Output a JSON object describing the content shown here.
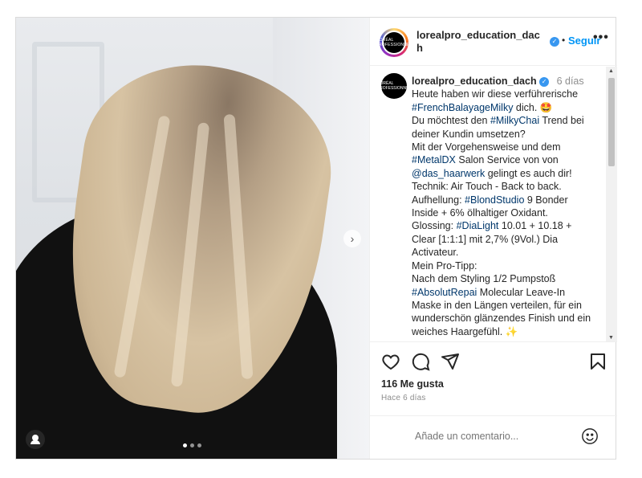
{
  "post": {
    "username": "lorealpro_education_dach",
    "username_wrapped": "lorealpro_education_dac h",
    "logo_text": "L'ORÉAL PROFESSIONNEL",
    "dot_separator": "•",
    "follow_label": "Seguir",
    "more_label": "•••",
    "next_arrow": "›"
  },
  "caption": {
    "username": "lorealpro_education_dach",
    "time": "6 días",
    "segments": [
      {
        "t": "Heute haben wir diese verführerische "
      },
      {
        "tag": "#FrenchBalayageMilky"
      },
      {
        "t": " dich. 🤩"
      },
      {
        "br": true
      },
      {
        "t": "Du möchtest den "
      },
      {
        "tag": "#MilkyChai"
      },
      {
        "t": " Trend bei deiner Kundin umsetzen?"
      },
      {
        "br": true
      },
      {
        "t": "Mit der Vorgehensweise und dem "
      },
      {
        "tag": "#MetalDX"
      },
      {
        "t": " Salon Service von von "
      },
      {
        "tag": "@das_haarwerk"
      },
      {
        "t": " gelingt es auch dir!"
      },
      {
        "br": true
      },
      {
        "t": "Technik: Air Touch - Back to back."
      },
      {
        "br": true
      },
      {
        "t": "Aufhellung: "
      },
      {
        "tag": "#BlondStudio"
      },
      {
        "t": " 9 Bonder Inside + 6% ölhaltiger Oxidant."
      },
      {
        "br": true
      },
      {
        "t": "Glossing: "
      },
      {
        "tag": "#DiaLight"
      },
      {
        "t": " 10.01 + 10.18 + Clear [1:1:1] mit 2,7% (9Vol.) Dia Activateur."
      },
      {
        "br": true
      },
      {
        "t": "Mein Pro-Tipp:"
      },
      {
        "br": true
      },
      {
        "t": "Nach dem Styling 1/2 Pumpstoß "
      },
      {
        "tag": "#AbsolutRepai"
      },
      {
        "t": " Molecular Leave-In Maske in den Längen verteilen, für ein wunderschön glänzendes Finish und ein weiches Haargefühl. ✨"
      }
    ]
  },
  "stats": {
    "likes": "116 Me gusta",
    "ago": "Hace 6 días"
  },
  "comment": {
    "placeholder": "Añade un comentario..."
  },
  "carousel": {
    "count": 3,
    "active_index": 0
  },
  "colors": {
    "link": "#00376b",
    "follow": "#0095f6",
    "verified": "#3897f0"
  }
}
